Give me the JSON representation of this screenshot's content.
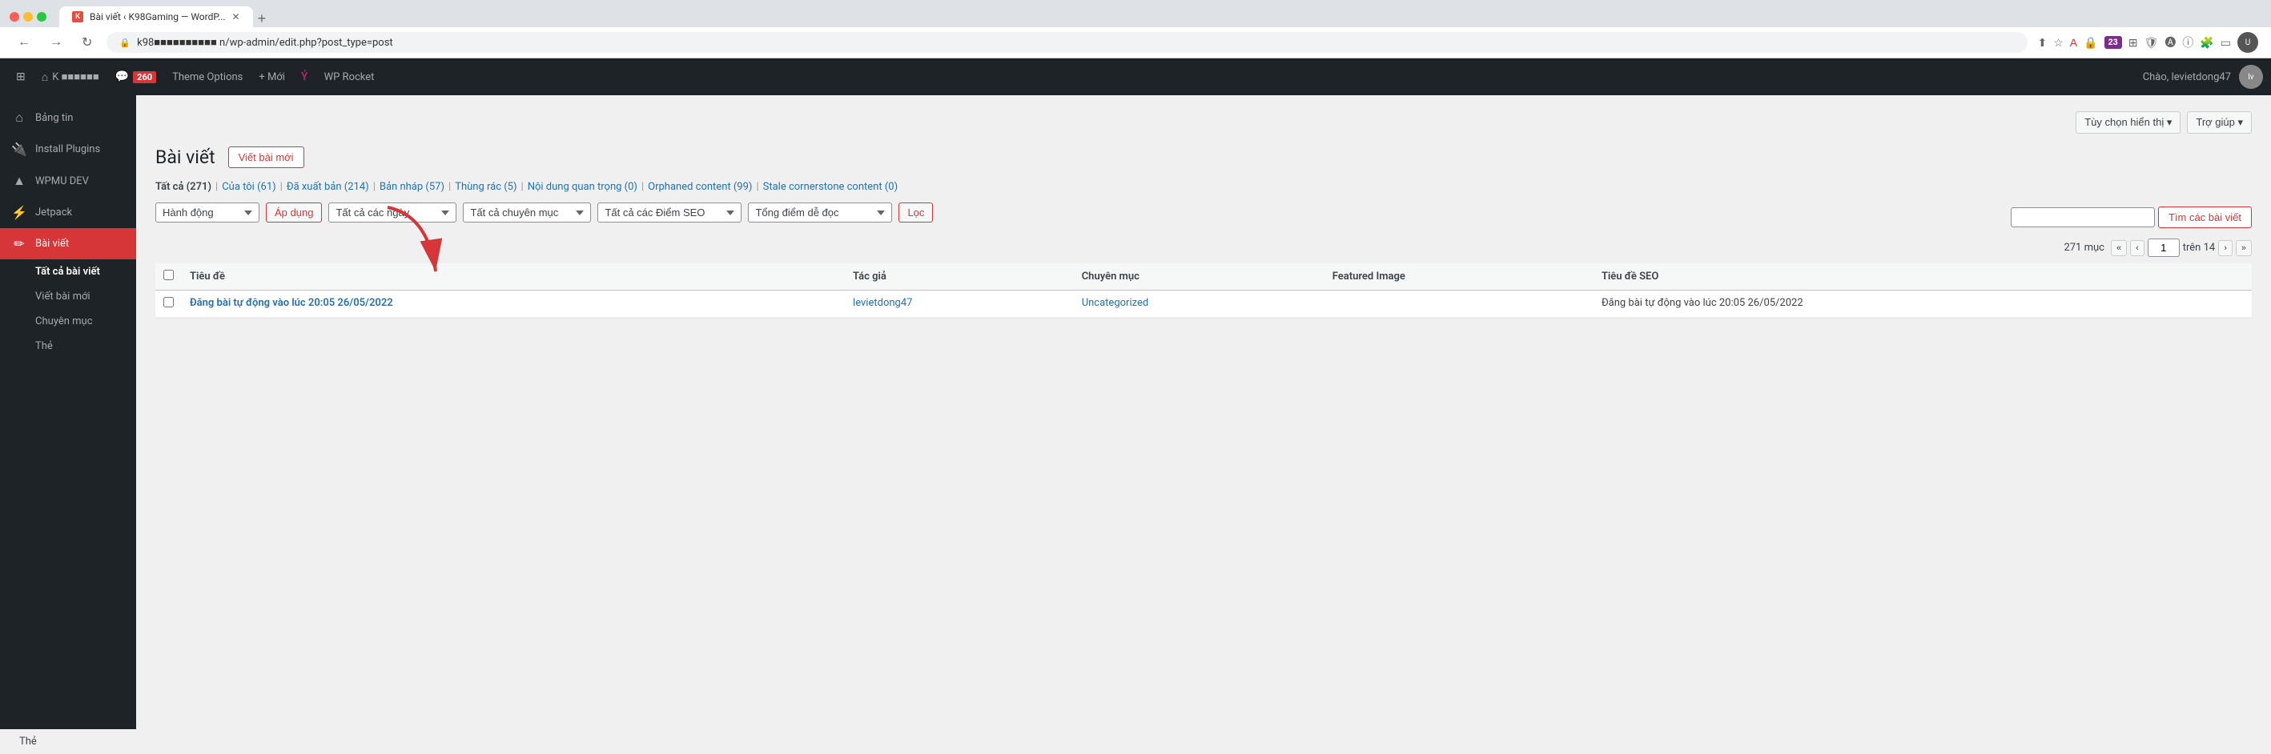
{
  "browser": {
    "tab_title": "Bài viết ‹ K98Gaming — WordP...",
    "tab_favicon": "K",
    "address_bar": "k98■■■■■■■■■■  n/wp-admin/edit.php?post_type=post",
    "address_lock": "🔒",
    "new_tab_label": "+"
  },
  "admin_bar": {
    "wp_icon": "⊞",
    "site_name": "K ■■■■■■",
    "comments_label": "260",
    "theme_options": "Theme Options",
    "new_label": "+ Mới",
    "yoast_icon": "Ý",
    "wp_rocket": "WP Rocket",
    "greeting": "Chào, levietdong47"
  },
  "sidebar": {
    "items": [
      {
        "id": "dashboard",
        "icon": "⌂",
        "label": "Bảng tin"
      },
      {
        "id": "plugins",
        "icon": "🔌",
        "label": "Install Plugins"
      },
      {
        "id": "wpmu",
        "icon": "▲",
        "label": "WPMU DEV"
      },
      {
        "id": "jetpack",
        "icon": "⚡",
        "label": "Jetpack"
      },
      {
        "id": "posts",
        "icon": "✏",
        "label": "Bài viết",
        "active": true
      }
    ],
    "submenu": [
      {
        "id": "all-posts",
        "label": "Tất cả bài viết",
        "active": true
      },
      {
        "id": "new-post",
        "label": "Viết bài mới"
      },
      {
        "id": "categories",
        "label": "Chuyên mục"
      },
      {
        "id": "tags",
        "label": "Thẻ"
      }
    ]
  },
  "content": {
    "topbar": {
      "display_options": "Tùy chọn hiển thị ▾",
      "help": "Trợ giúp ▾"
    },
    "page_title": "Bài viết",
    "new_post_btn": "Viết bài mới",
    "filter_tabs": [
      {
        "id": "all",
        "label": "Tất cả",
        "count": "271",
        "current": true
      },
      {
        "id": "mine",
        "label": "Của tôi",
        "count": "61"
      },
      {
        "id": "published",
        "label": "Đã xuất bản",
        "count": "214"
      },
      {
        "id": "draft",
        "label": "Bản nháp",
        "count": "57"
      },
      {
        "id": "trash",
        "label": "Thùng rác",
        "count": "5"
      },
      {
        "id": "important",
        "label": "Nội dung quan trọng",
        "count": "0"
      },
      {
        "id": "orphaned",
        "label": "Orphaned content",
        "count": "99"
      },
      {
        "id": "cornerstone",
        "label": "Stale cornerstone content",
        "count": "0"
      }
    ],
    "action_bar": {
      "action_select_default": "Hành động",
      "apply_btn": "Áp dụng",
      "date_select_default": "Tất cả các ngày",
      "category_select_default": "Tất cả chuyên mục",
      "seo_select_default": "Tất cả các Điểm SEO",
      "readability_select_default": "Tổng điểm dễ đọc",
      "filter_btn": "Lọc",
      "search_placeholder": ""
    },
    "search": {
      "btn_label": "Tìm các bài viết"
    },
    "pagination": {
      "total": "271 mục",
      "first_page": "«",
      "prev_page": "‹",
      "current_page": "1",
      "total_pages": "trên 14",
      "next_page": "›",
      "last_page": "»"
    },
    "table": {
      "columns": [
        {
          "id": "cb",
          "label": ""
        },
        {
          "id": "title",
          "label": "Tiêu đề"
        },
        {
          "id": "author",
          "label": "Tác giả"
        },
        {
          "id": "category",
          "label": "Chuyên mục"
        },
        {
          "id": "featured",
          "label": "Featured Image"
        },
        {
          "id": "seo-title",
          "label": "Tiêu đề SEO"
        }
      ],
      "rows": [
        {
          "id": 1,
          "title": "Đăng bài tự động vào lúc 20:05 26/05/2022",
          "author": "levietdong47",
          "category": "Uncategorized",
          "featured": "",
          "seo_title": "Đăng bài tự động vào lúc 20:05 26/05/2022"
        }
      ]
    }
  },
  "bottom": {
    "text": "Thẻ"
  }
}
